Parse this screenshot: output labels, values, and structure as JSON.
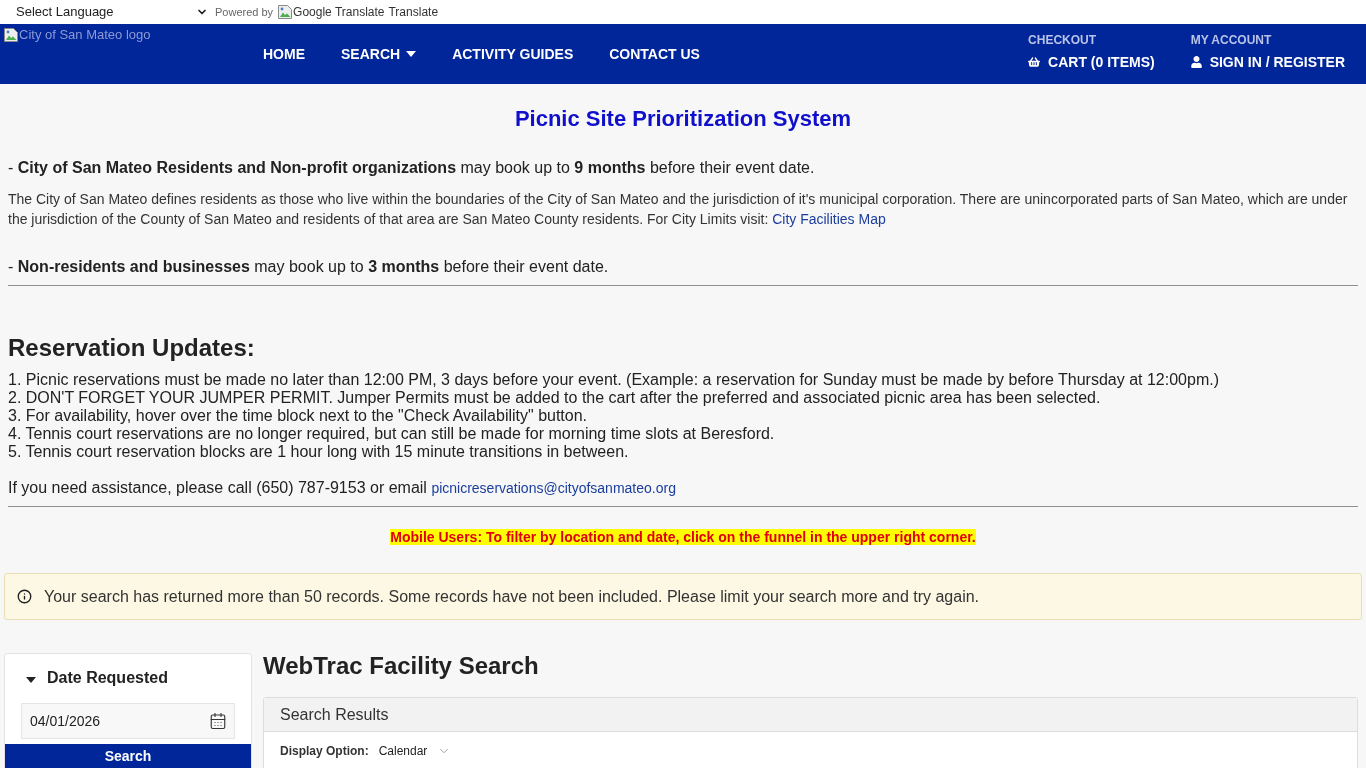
{
  "language_bar": {
    "select": {
      "value": "Select Language"
    },
    "powered_by": "Powered by",
    "translate_image_alt": "Google Translate",
    "translate_link": "Translate"
  },
  "header": {
    "logo_alt": "City of San Mateo logo",
    "nav": [
      {
        "label": "HOME",
        "kind": "link"
      },
      {
        "label": "SEARCH",
        "kind": "dropdown"
      },
      {
        "label": "ACTIVITY GUIDES",
        "kind": "link"
      },
      {
        "label": "CONTACT US",
        "kind": "link"
      }
    ],
    "account_links": [
      {
        "label": "CHECKOUT",
        "link": "CART (0 ITEMS)",
        "kind": "cart"
      },
      {
        "label": "MY ACCOUNT",
        "link": "SIGN IN / REGISTER",
        "kind": "account"
      }
    ]
  },
  "intro": {
    "title": "Picnic Site Prioritization System",
    "residents_rule": "- **City of San Mateo Residents and Non-profit organizations** may book up to **9 months** before their event date.",
    "residents_note": "The City of San Mateo defines residents as those who live within the boundaries of the City of San Mateo and the jurisdiction of it's municipal corporation. There are unincorporated parts of San Mateo, which are under the jurisdiction of the County of San Mateo and residents of that area are San Mateo County residents. For City Limits visit:",
    "residents_note_link": "City Facilities Map",
    "nonresidents_rule": "- **Non-residents and businesses** may book up to **3 months** before their event date."
  },
  "updates": {
    "heading": "Reservation Updates:",
    "items": [
      "1. Picnic reservations must be made no later than 12:00 PM, 3 days before your event. (Example: a reservation for Sunday must be made by before Thursday at 12:00pm.)",
      "2. DON'T FORGET YOUR JUMPER PERMIT. Jumper Permits must be added to the cart after the preferred and associated picnic area has been selected.",
      "3. For availability, hover over the time block next to the \"Check Availability\" button.",
      "4. Tennis court reservations are no longer required, but can still be made for morning time slots at Beresford.",
      "5. Tennis court reservation blocks are 1 hour long with 15 minute transitions in between."
    ],
    "assistance": "If you need assistance, please call (650) 787-9153 or email",
    "assistance_link": "picnicreservations@cityofsanmateo.org"
  },
  "mobile_notice": "Mobile Users: To filter by location and date, click on the funnel in the upper right corner.",
  "alert": "Your search has returned more than 50 records. Some records have not been included. Please limit your search more and try again.",
  "sidebar": {
    "section": {
      "title": "Date Requested",
      "expanded": true
    },
    "date_field": {
      "value": "04/01/2026"
    },
    "search_button": "Search"
  },
  "main": {
    "title": "WebTrac Facility Search",
    "results_panel": {
      "title": "Search Results",
      "display_option": {
        "label": "Display Option:",
        "value": "Calendar"
      }
    }
  }
}
